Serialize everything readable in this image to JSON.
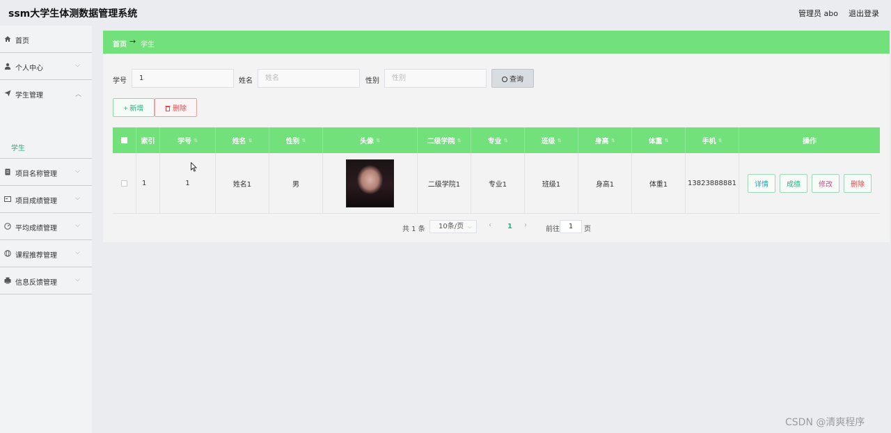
{
  "header": {
    "title": "ssm大学生体测数据管理系统",
    "user": "管理员 abo",
    "logout": "退出登录"
  },
  "sidebar": {
    "items": [
      {
        "label": "首页",
        "icon": "home-icon"
      },
      {
        "label": "个人中心",
        "icon": "user-icon"
      },
      {
        "label": "学生管理",
        "icon": "send-icon",
        "sub": "学生"
      },
      {
        "label": "项目名称管理",
        "icon": "document-icon"
      },
      {
        "label": "项目成绩管理",
        "icon": "card-icon"
      },
      {
        "label": "平均成绩管理",
        "icon": "gauge-icon"
      },
      {
        "label": "课程推荐管理",
        "icon": "globe-icon"
      },
      {
        "label": "信息反馈管理",
        "icon": "printer-icon"
      }
    ]
  },
  "breadcrumb": {
    "home": "首页",
    "arrow": "→",
    "current": "学生"
  },
  "filters": {
    "student_no_label": "学号",
    "student_no_value": "1",
    "name_label": "姓名",
    "name_placeholder": "姓名",
    "gender_label": "性别",
    "gender_placeholder": "性别",
    "query_label": "查询"
  },
  "actions": {
    "add_label": "+ 新增",
    "delete_label": "删除"
  },
  "table": {
    "headers": [
      "索引",
      "学号",
      "姓名",
      "性别",
      "头像",
      "二级学院",
      "专业",
      "班级",
      "身高",
      "体重",
      "手机",
      "操作"
    ],
    "rows": [
      {
        "index": "1",
        "student_no": "1",
        "name": "姓名1",
        "gender": "男",
        "college": "二级学院1",
        "major": "专业1",
        "class": "班级1",
        "height": "身高1",
        "weight": "体重1",
        "phone": "13823888881",
        "ops": [
          "详情",
          "成绩",
          "修改",
          "删除"
        ]
      }
    ]
  },
  "pagination": {
    "total": "共 1 条",
    "page_size": "10条/页",
    "prev": "‹",
    "current": "1",
    "next": "›",
    "goto": "前往",
    "goto_value": "1",
    "page_unit": "页"
  },
  "watermark": "CSDN @清爽程序",
  "colors": {
    "accent_green": "#72e07b",
    "active_green": "#2ab07a",
    "danger_red": "#e04848"
  }
}
